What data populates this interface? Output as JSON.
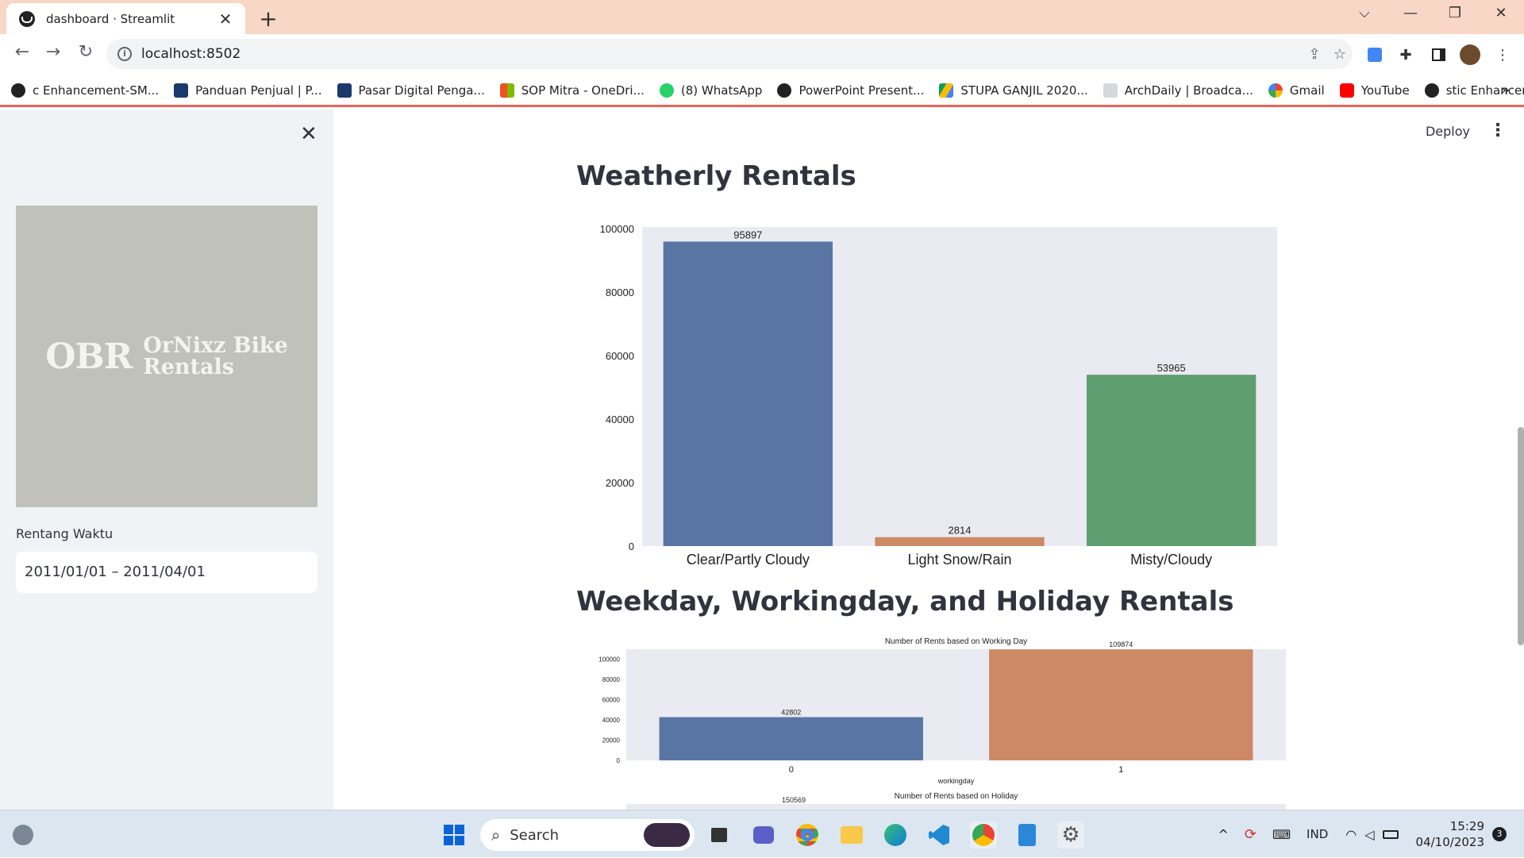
{
  "browser": {
    "tab_title": "dashboard · Streamlit",
    "url": "localhost:8502",
    "bookmarks": [
      {
        "label": "c Enhancement-SM...",
        "color": "#222222"
      },
      {
        "label": "Panduan Penjual | P...",
        "color": "#1a3a6b"
      },
      {
        "label": "Pasar Digital Penga...",
        "color": "#1a3a6b"
      },
      {
        "label": "SOP Mitra - OneDri...",
        "color": "#f25022"
      },
      {
        "label": "(8) WhatsApp",
        "color": "#25d366"
      },
      {
        "label": "PowerPoint Present...",
        "color": "#222222"
      },
      {
        "label": "STUPA GANJIL 2020...",
        "color": "#fbbc04"
      },
      {
        "label": "ArchDaily | Broadca...",
        "color": "#9aa0a6"
      },
      {
        "label": "Gmail",
        "color": "#ea4335"
      },
      {
        "label": "YouTube",
        "color": "#ff0000"
      },
      {
        "label": "stic Enhancement-S...",
        "color": "#222222"
      }
    ],
    "bookmarks_more": "»"
  },
  "app": {
    "deploy_label": "Deploy",
    "sidebar": {
      "logo_monogram": "OBR",
      "logo_line1": "OrNixz Bike",
      "logo_line2": "Rentals",
      "date_label": "Rentang Waktu",
      "date_value": "2011/01/01 – 2011/04/01"
    },
    "sections": {
      "weather_title": "Weatherly Rentals",
      "weekday_title": "Weekday, Workingday, and Holiday Rentals"
    }
  },
  "chart_data": [
    {
      "type": "bar",
      "categories": [
        "Clear/Partly Cloudy",
        "Light Snow/Rain",
        "Misty/Cloudy"
      ],
      "values": [
        95897,
        2814,
        53965
      ],
      "colors": [
        "#5975a4",
        "#cc8963",
        "#5f9e6e"
      ],
      "yticks": [
        0,
        20000,
        40000,
        60000,
        80000,
        100000
      ],
      "ylim": [
        0,
        100000
      ],
      "title": "",
      "xlabel": "",
      "ylabel": ""
    },
    {
      "type": "bar",
      "title": "Number of Rents based on Working Day",
      "categories": [
        "0",
        "1"
      ],
      "values": [
        42802,
        109874
      ],
      "colors": [
        "#5975a4",
        "#cc8963"
      ],
      "yticks": [
        0,
        20000,
        40000,
        60000,
        80000,
        100000
      ],
      "ylim": [
        0,
        110000
      ],
      "xlabel": "workingday",
      "ylabel": ""
    },
    {
      "type": "bar",
      "title": "Number of Rents based on Holiday",
      "visible_labels": [
        "150569"
      ]
    }
  ],
  "taskbar": {
    "search_placeholder": "Search",
    "lang": "IND",
    "time": "15:29",
    "date": "04/10/2023",
    "notif_count": "3"
  }
}
